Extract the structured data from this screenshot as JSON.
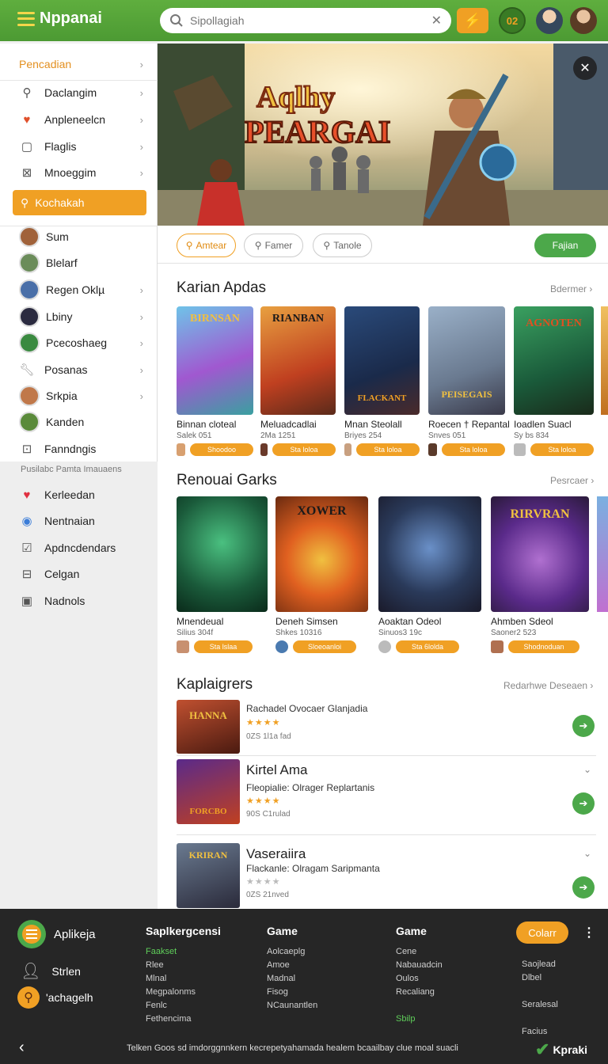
{
  "header": {
    "brand": "Nppanai",
    "brand_sub": "",
    "search_placeholder": "Sipollagiah",
    "badge": "02"
  },
  "sidebar": {
    "section_title": "Pencadian",
    "items": [
      {
        "label": "Daclangim",
        "icon": "search-icon"
      },
      {
        "label": "Anpleneelcn",
        "icon": "heart-icon"
      },
      {
        "label": "Flaglis",
        "icon": "square-icon"
      },
      {
        "label": "Mnoeggim",
        "icon": "cross-box-icon"
      }
    ],
    "active_label": "Kochakah",
    "people": [
      {
        "label": "Sum"
      },
      {
        "label": "Blelarf"
      },
      {
        "label": "Regen Oklµ"
      },
      {
        "label": "Lbiny"
      },
      {
        "label": "Pcecoshaeg"
      },
      {
        "label": "Posanas"
      },
      {
        "label": "Srkpia"
      },
      {
        "label": "Kanden"
      },
      {
        "label": "Fanndngis"
      }
    ],
    "group_title": "Pusilabc Pamta Imauaens",
    "group_items": [
      {
        "label": "Kerleedan"
      },
      {
        "label": "Nentnaian"
      },
      {
        "label": "Apdncdendars"
      },
      {
        "label": "Celgan"
      },
      {
        "label": "Nadnols"
      }
    ]
  },
  "banner": {
    "title_line1": "Aqlhy",
    "title_line2": "PEARGAI"
  },
  "filters": {
    "pills": [
      "Amtear",
      "Famer",
      "Tanole"
    ],
    "primary": "Fajian"
  },
  "section1": {
    "title": "Karian Apdas",
    "more": "Bdermer",
    "cards": [
      {
        "name": "Binnan cloteal",
        "sub": "Salek 051",
        "btn": "Shoodoo",
        "cover_title": "BIRNSAN"
      },
      {
        "name": "Meluadcadlai",
        "sub": "2Ma 1251",
        "btn": "Sta loloa",
        "cover_title": "RIANBAN"
      },
      {
        "name": "Mnan Steolall",
        "sub": "Briyes 254",
        "btn": "Sta loloa",
        "cover_title": "FLACKANT"
      },
      {
        "name": "Roecen † Repantal",
        "sub": "Snves 051",
        "btn": "Sta loloa",
        "cover_title": "PEISEGAIS"
      },
      {
        "name": "Ioadlen Suacl",
        "sub": "Sy bs 834",
        "btn": "Sta loloa",
        "cover_title": "AGNOTEN"
      }
    ]
  },
  "section2": {
    "title": "Renouai Garks",
    "more": "Pesrcaer",
    "cards": [
      {
        "name": "Mnendeual",
        "sub": "Silius 304f",
        "btn": "Sta lslaa",
        "cover_title": ""
      },
      {
        "name": "Deneh Simsen",
        "sub": "Shkes 10316",
        "btn": "Sloeoanloi",
        "cover_title": "XOWER"
      },
      {
        "name": "Aoaktan Odeol",
        "sub": "Sinuos3 19c",
        "btn": "Sta 6lolda",
        "cover_title": ""
      },
      {
        "name": "Ahmben Sdeol",
        "sub": "Saoner2 523",
        "btn": "Shodnoduan",
        "cover_title": "RIRVRAN"
      }
    ]
  },
  "section3": {
    "title": "Kaplaigrers",
    "more": "Redarhwe Deseaen",
    "rows": [
      {
        "name": "",
        "sub": "Rachadel Ovocaer Glanjadia",
        "stars": "★★★★",
        "meta": "0ZS 1l1a fad",
        "thumb_title": "HANNA"
      },
      {
        "name": "Kirtel Ama",
        "sub": "Fleopialie: Olrager Replartanis",
        "stars": "★★★★",
        "meta": "90S C1rulad",
        "thumb_title": "FORCBO"
      },
      {
        "name": "Vaseraiira",
        "sub": "Flackanle: Olragam Saripmanta",
        "stars": "★★★★",
        "meta": "0ZS 21nved",
        "thumb_title": "KRIRAN"
      }
    ]
  },
  "footer": {
    "brand": "Aplikeja",
    "side_links": [
      "Strlen",
      "'achagelh"
    ],
    "columns": [
      {
        "title": "Saplkergcensi",
        "links": [
          "Faakset",
          "Rlee",
          "Mlnal",
          "Megpalonms",
          "Fenlc",
          "Fethencima"
        ]
      },
      {
        "title": "Game",
        "links": [
          "Aolcaeplg",
          "Amoe",
          "Madnal",
          "Fisog",
          "NCaunantlen"
        ]
      },
      {
        "title": "Game",
        "links": [
          "Cene",
          "Nabauadcin",
          "Oulos",
          "Recaliang",
          "",
          "Sbilp"
        ]
      },
      {
        "title": "",
        "links": [
          "Saojlead",
          "Dlbel",
          "",
          "Seralesal",
          "",
          "Facius"
        ]
      }
    ],
    "cta": "Colarr",
    "bottom_text": "Telken Goos sd imdorggnnkern kecrepetyahamada healem bcaailbay clue moal suacli",
    "bottom_brand": "Kpraki"
  }
}
